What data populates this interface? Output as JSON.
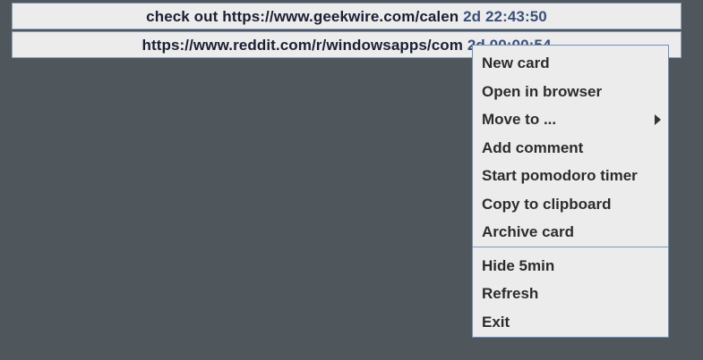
{
  "cards": [
    {
      "text": "check out https://www.geekwire.com/calen",
      "time": "2d 22:43:50"
    },
    {
      "text": "https://www.reddit.com/r/windowsapps/com",
      "time": "2d 00:00:54"
    }
  ],
  "context_menu": {
    "items": [
      {
        "label": "New card"
      },
      {
        "label": "Open in browser"
      },
      {
        "label": "Move to ...",
        "has_submenu": true,
        "submenu_icon": "triangle-right-icon"
      },
      {
        "label": "Add comment"
      },
      {
        "label": "Start pomodoro timer"
      },
      {
        "label": "Copy to clipboard"
      },
      {
        "label": "Archive card"
      },
      {
        "label": "Hide 5min"
      },
      {
        "label": "Refresh"
      },
      {
        "label": "Exit"
      }
    ]
  },
  "colors": {
    "background": "#4f565c",
    "card_background": "#ececec",
    "card_text": "#1b1f33",
    "time_text": "#3a4f79",
    "menu_border": "#6f8fbc"
  }
}
